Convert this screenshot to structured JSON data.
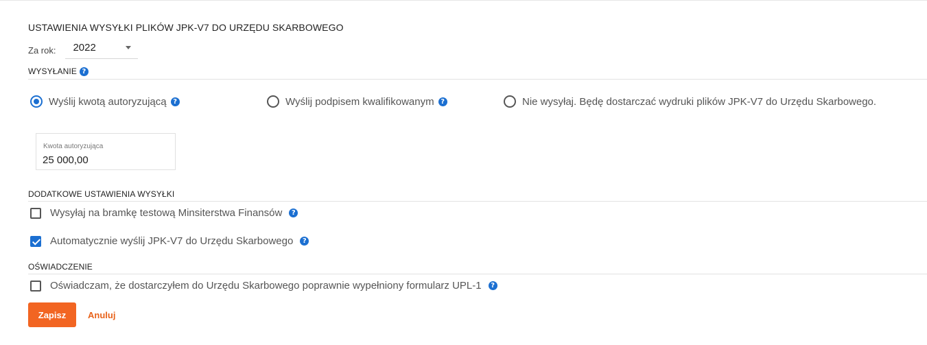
{
  "title": "USTAWIENIA WYSYŁKI PLIKÓW JPK-V7 DO URZĘDU SKARBOWEGO",
  "year": {
    "label": "Za rok:",
    "value": "2022"
  },
  "sending": {
    "header": "WYSYŁANIE",
    "options": [
      {
        "label": "Wyślij kwotą autoryzującą",
        "selected": true,
        "help": true
      },
      {
        "label": "Wyślij podpisem kwalifikowanym",
        "selected": false,
        "help": true
      },
      {
        "label": "Nie wysyłaj. Będę dostarczać wydruki plików JPK-V7 do Urzędu Skarbowego.",
        "selected": false,
        "help": false
      }
    ],
    "amount": {
      "label": "Kwota autoryzująca",
      "value": "25 000,00"
    }
  },
  "additional": {
    "header": "DODATKOWE USTAWIENIA WYSYŁKI",
    "items": [
      {
        "label": "Wysyłaj na bramkę testową Minsiterstwa Finansów",
        "checked": false
      },
      {
        "label": "Automatycznie wyślij JPK-V7 do Urzędu Skarbowego",
        "checked": true
      }
    ]
  },
  "declaration": {
    "header": "OŚWIADCZENIE",
    "label": "Oświadczam, że dostarczyłem do Urzędu Skarbowego poprawnie wypełniony formularz UPL-1",
    "checked": false
  },
  "buttons": {
    "save": "Zapisz",
    "cancel": "Anuluj"
  },
  "icons": {
    "help": "?"
  },
  "colors": {
    "accent": "#1b6fd1",
    "primary_button": "#f26522",
    "link": "#e8621a"
  }
}
